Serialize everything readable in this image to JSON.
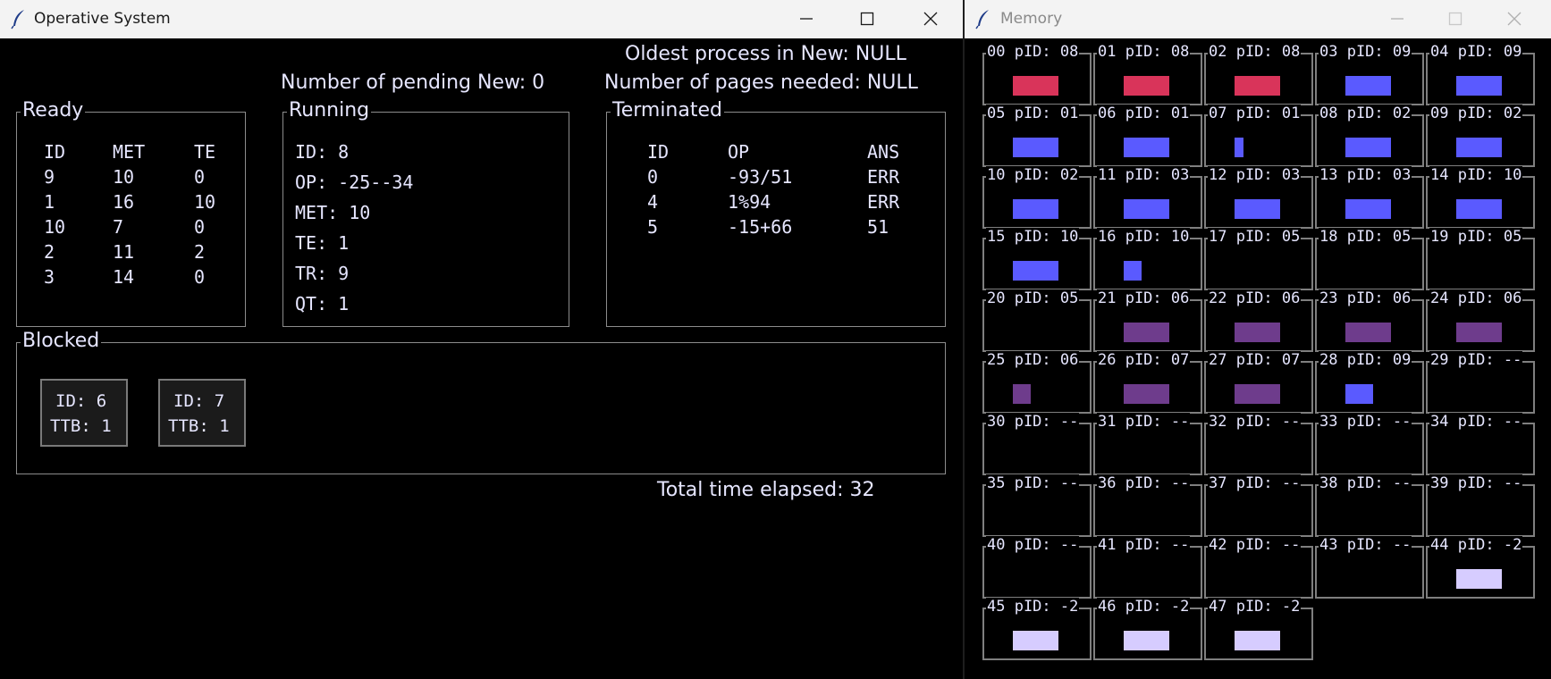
{
  "os_window": {
    "title": "Operative System",
    "icon": "feather-icon",
    "controls": [
      "minimize-icon",
      "maximize-icon",
      "close-icon"
    ],
    "oldest_process": "Oldest process in New: NULL",
    "pending_new": "Number of pending New: 0",
    "pages_needed": "Number of pages needed: NULL",
    "ready": {
      "title": "Ready",
      "headers": [
        "ID",
        "MET",
        "TE"
      ],
      "rows": [
        [
          "9",
          "10",
          "0"
        ],
        [
          "1",
          "16",
          "10"
        ],
        [
          "10",
          "7",
          "0"
        ],
        [
          "2",
          "11",
          "2"
        ],
        [
          "3",
          "14",
          "0"
        ]
      ]
    },
    "running": {
      "title": "Running",
      "lines": [
        "ID: 8",
        "OP: -25--34",
        "MET: 10",
        "TE: 1",
        "TR: 9",
        "QT: 1"
      ]
    },
    "terminated": {
      "title": "Terminated",
      "headers": [
        "ID",
        "OP",
        "ANS"
      ],
      "rows": [
        [
          "0",
          "-93/51",
          "ERR"
        ],
        [
          "4",
          "1%94",
          "ERR"
        ],
        [
          "5",
          "-15+66",
          "51"
        ]
      ]
    },
    "blocked": {
      "title": "Blocked",
      "cards": [
        {
          "id": "ID: 6",
          "ttb": "TTB: 1"
        },
        {
          "id": "ID: 7",
          "ttb": "TTB: 1"
        }
      ]
    },
    "total_time": "Total time elapsed: 32"
  },
  "memory_window": {
    "title": "Memory",
    "icon": "feather-icon",
    "controls": [
      "minimize-icon",
      "maximize-icon",
      "close-icon"
    ],
    "colors": {
      "red": "#d9345a",
      "blue": "#5a5aff",
      "purple": "#6e3c8c",
      "lavender": "#d6ccff"
    },
    "frames": [
      {
        "label": "00 pID: 08",
        "fill": 1.0,
        "color": "red"
      },
      {
        "label": "01 pID: 08",
        "fill": 1.0,
        "color": "red"
      },
      {
        "label": "02 pID: 08",
        "fill": 1.0,
        "color": "red"
      },
      {
        "label": "03 pID: 09",
        "fill": 1.0,
        "color": "blue"
      },
      {
        "label": "04 pID: 09",
        "fill": 1.0,
        "color": "blue"
      },
      {
        "label": "05 pID: 01",
        "fill": 1.0,
        "color": "blue"
      },
      {
        "label": "06 pID: 01",
        "fill": 1.0,
        "color": "blue"
      },
      {
        "label": "07 pID: 01",
        "fill": 0.2,
        "color": "blue"
      },
      {
        "label": "08 pID: 02",
        "fill": 1.0,
        "color": "blue"
      },
      {
        "label": "09 pID: 02",
        "fill": 1.0,
        "color": "blue"
      },
      {
        "label": "10 pID: 02",
        "fill": 1.0,
        "color": "blue"
      },
      {
        "label": "11 pID: 03",
        "fill": 1.0,
        "color": "blue"
      },
      {
        "label": "12 pID: 03",
        "fill": 1.0,
        "color": "blue"
      },
      {
        "label": "13 pID: 03",
        "fill": 1.0,
        "color": "blue"
      },
      {
        "label": "14 pID: 10",
        "fill": 1.0,
        "color": "blue"
      },
      {
        "label": "15 pID: 10",
        "fill": 1.0,
        "color": "blue"
      },
      {
        "label": "16 pID: 10",
        "fill": 0.4,
        "color": "blue"
      },
      {
        "label": "17 pID: 05",
        "fill": 0,
        "color": "none"
      },
      {
        "label": "18 pID: 05",
        "fill": 0,
        "color": "none"
      },
      {
        "label": "19 pID: 05",
        "fill": 0,
        "color": "none"
      },
      {
        "label": "20 pID: 05",
        "fill": 0,
        "color": "none"
      },
      {
        "label": "21 pID: 06",
        "fill": 1.0,
        "color": "purple"
      },
      {
        "label": "22 pID: 06",
        "fill": 1.0,
        "color": "purple"
      },
      {
        "label": "23 pID: 06",
        "fill": 1.0,
        "color": "purple"
      },
      {
        "label": "24 pID: 06",
        "fill": 1.0,
        "color": "purple"
      },
      {
        "label": "25 pID: 06",
        "fill": 0.4,
        "color": "purple"
      },
      {
        "label": "26 pID: 07",
        "fill": 1.0,
        "color": "purple"
      },
      {
        "label": "27 pID: 07",
        "fill": 1.0,
        "color": "purple"
      },
      {
        "label": "28 pID: 09",
        "fill": 0.6,
        "color": "blue"
      },
      {
        "label": "29 pID: --",
        "fill": 0,
        "color": "none"
      },
      {
        "label": "30 pID: --",
        "fill": 0,
        "color": "none"
      },
      {
        "label": "31 pID: --",
        "fill": 0,
        "color": "none"
      },
      {
        "label": "32 pID: --",
        "fill": 0,
        "color": "none"
      },
      {
        "label": "33 pID: --",
        "fill": 0,
        "color": "none"
      },
      {
        "label": "34 pID: --",
        "fill": 0,
        "color": "none"
      },
      {
        "label": "35 pID: --",
        "fill": 0,
        "color": "none"
      },
      {
        "label": "36 pID: --",
        "fill": 0,
        "color": "none"
      },
      {
        "label": "37 pID: --",
        "fill": 0,
        "color": "none"
      },
      {
        "label": "38 pID: --",
        "fill": 0,
        "color": "none"
      },
      {
        "label": "39 pID: --",
        "fill": 0,
        "color": "none"
      },
      {
        "label": "40 pID: --",
        "fill": 0,
        "color": "none"
      },
      {
        "label": "41 pID: --",
        "fill": 0,
        "color": "none"
      },
      {
        "label": "42 pID: --",
        "fill": 0,
        "color": "none"
      },
      {
        "label": "43 pID: --",
        "fill": 0,
        "color": "none"
      },
      {
        "label": "44 pID: -2",
        "fill": 1.0,
        "color": "lavender"
      },
      {
        "label": "45 pID: -2",
        "fill": 1.0,
        "color": "lavender"
      },
      {
        "label": "46 pID: -2",
        "fill": 1.0,
        "color": "lavender"
      },
      {
        "label": "47 pID: -2",
        "fill": 1.0,
        "color": "lavender"
      }
    ]
  }
}
